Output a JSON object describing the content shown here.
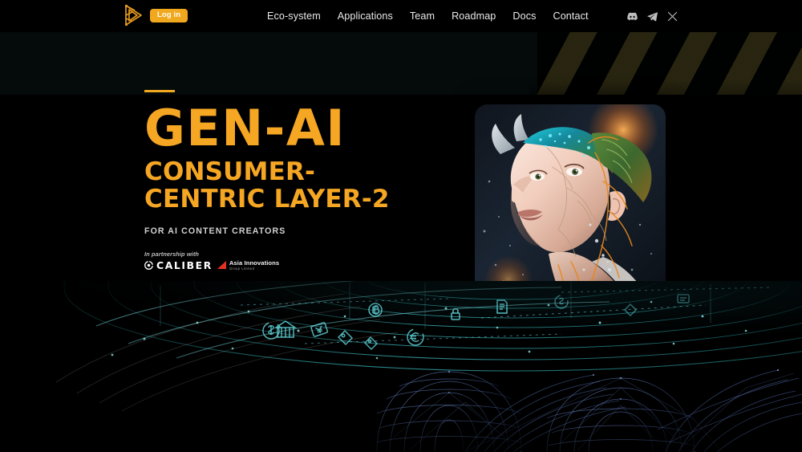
{
  "header": {
    "logo_icon": "penrose-triangle-logo-icon",
    "login_label": "Log in",
    "nav": [
      {
        "label": "Eco-system"
      },
      {
        "label": "Applications"
      },
      {
        "label": "Team"
      },
      {
        "label": "Roadmap"
      },
      {
        "label": "Docs"
      },
      {
        "label": "Contact"
      }
    ],
    "socials": [
      {
        "name": "discord-icon"
      },
      {
        "name": "telegram-icon"
      },
      {
        "name": "x-twitter-icon"
      }
    ]
  },
  "hero": {
    "title_main": "GEN-AI",
    "title_sub_line1": "CONSUMER-",
    "title_sub_line2": "CENTRIC LAYER-2",
    "tagline": "FOR AI CONTENT CREATORS",
    "partner": {
      "kicker": "In partnership with",
      "caliber_name": "CALIBER",
      "aig_name": "Asia Innovations",
      "aig_sub": "Group Limited"
    },
    "portrait_alt": "ai-generated-cyborg-woman-portrait"
  },
  "colors": {
    "accent": "#f5a623",
    "login_bg": "#f0a81e",
    "nav_text": "#e9e9ea",
    "tagline": "#d2d2d4",
    "orbit_teal": "#2fb3b8",
    "mesh_blue": "#5b7fd4",
    "background": "#000000",
    "hero_band": "#050a0a"
  },
  "background": {
    "orbital_rings_label": "fintech-orbital-rings",
    "orbital_icons": [
      "currency-refresh-icon",
      "bank-building-icon",
      "yen-note-icon",
      "price-tag-icon",
      "euro-refresh-icon",
      "bitcoin-icon",
      "lock-icon",
      "document-icon"
    ],
    "wireframe_label": "blue-wireframe-dome-mesh",
    "stripes_label": "diagonal-olive-stripes"
  }
}
